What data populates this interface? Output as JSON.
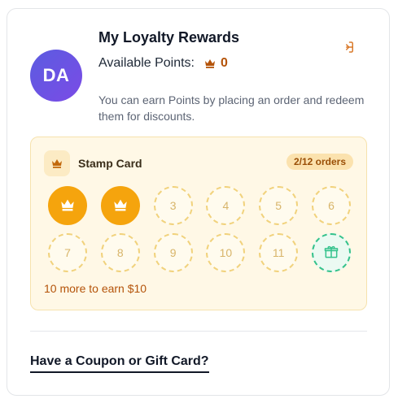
{
  "profile": {
    "initials": "DA",
    "title": "My Loyalty Rewards",
    "points_label": "Available Points:",
    "points_value": "0",
    "description": "You can earn Points by placing an order and redeem them for discounts."
  },
  "icons": {
    "logout": "logout-icon",
    "crown": "crown-icon",
    "gift": "gift-icon"
  },
  "stamp_card": {
    "title": "Stamp Card",
    "progress": "2/12 orders",
    "stamps": [
      {
        "label": "",
        "state": "filled"
      },
      {
        "label": "",
        "state": "filled"
      },
      {
        "label": "3",
        "state": "empty"
      },
      {
        "label": "4",
        "state": "empty"
      },
      {
        "label": "5",
        "state": "empty"
      },
      {
        "label": "6",
        "state": "empty"
      },
      {
        "label": "7",
        "state": "empty"
      },
      {
        "label": "8",
        "state": "empty"
      },
      {
        "label": "9",
        "state": "empty"
      },
      {
        "label": "10",
        "state": "empty"
      },
      {
        "label": "11",
        "state": "empty"
      },
      {
        "label": "",
        "state": "gift"
      }
    ],
    "footer": "10 more to earn $10"
  },
  "coupon": {
    "link_label": "Have a Coupon or Gift Card?"
  },
  "colors": {
    "accent": "#f5a40d",
    "points": "#b45309",
    "gift": "#34c28c",
    "avatar_start": "#5b5ce0",
    "avatar_end": "#7b4be6"
  }
}
